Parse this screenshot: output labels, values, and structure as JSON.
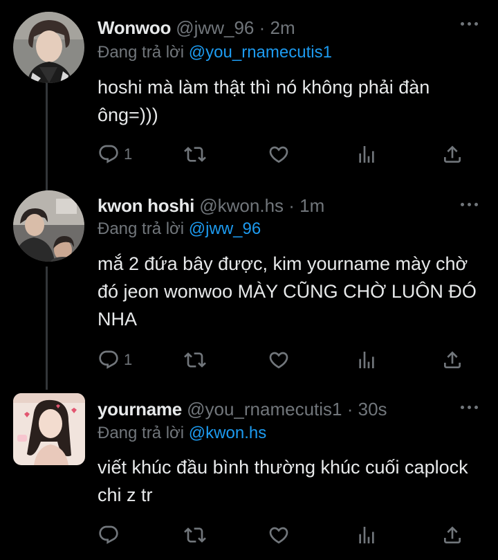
{
  "colors": {
    "background": "#000000",
    "text": "#e7e9ea",
    "muted": "#71767b",
    "link": "#1d9bf0",
    "thread_line": "#333639"
  },
  "tweets": [
    {
      "name": "Wonwoo",
      "handle": "@jww_96",
      "separator": "·",
      "time": "2m",
      "reply_prefix": "Đang trả lời",
      "reply_to": "@you_rnamecutis1",
      "text": "hoshi mà làm thật thì nó không phải đàn ông=)))",
      "reply_count": "1",
      "icons": [
        "reply-icon",
        "retweet-icon",
        "like-icon",
        "views-icon",
        "share-icon"
      ]
    },
    {
      "name": "kwon hoshi",
      "handle": "@kwon.hs",
      "separator": "·",
      "time": "1m",
      "reply_prefix": "Đang trả lời",
      "reply_to": "@jww_96",
      "text": "mắ 2 đứa bây được, kim yourname mày chờ đó jeon wonwoo MÀY CŨNG CHỜ LUÔN ĐÓ NHA",
      "reply_count": "1",
      "icons": [
        "reply-icon",
        "retweet-icon",
        "like-icon",
        "views-icon",
        "share-icon"
      ]
    },
    {
      "name": "yourname",
      "handle": "@you_rnamecutis1",
      "separator": "·",
      "time": "30s",
      "reply_prefix": "Đang trả lời",
      "reply_to": "@kwon.hs",
      "text": "viết khúc đầu bình thường khúc cuối caplock chi z tr",
      "reply_count": "",
      "icons": [
        "reply-icon",
        "retweet-icon",
        "like-icon",
        "views-icon",
        "share-icon"
      ]
    }
  ]
}
